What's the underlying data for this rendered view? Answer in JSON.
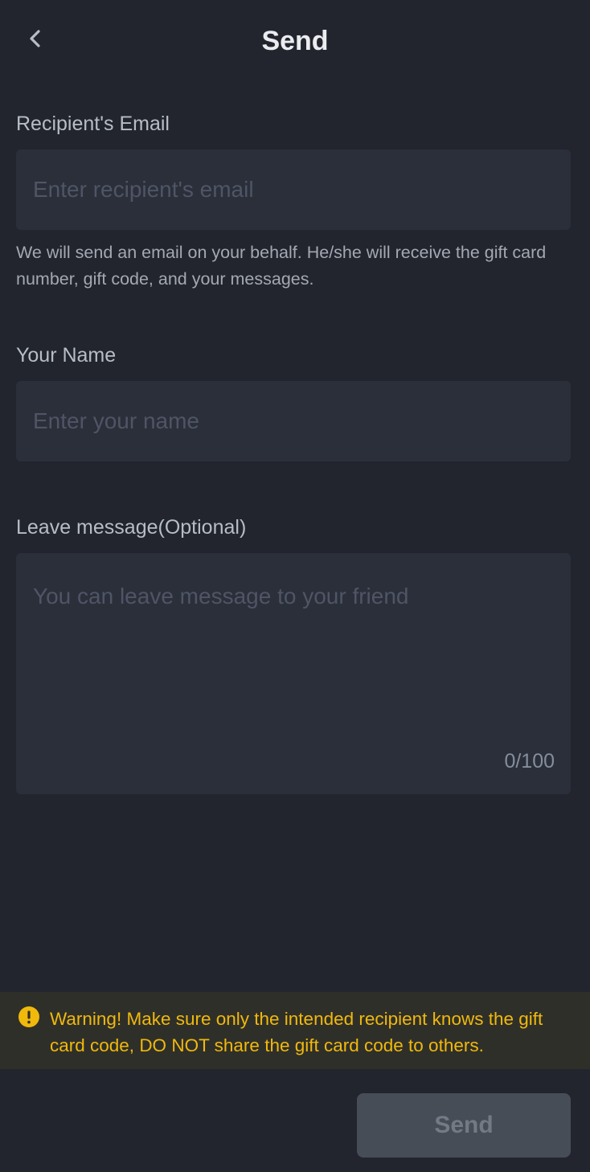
{
  "header": {
    "back_icon": "chevron-left-icon",
    "title": "Send"
  },
  "form": {
    "email": {
      "label": "Recipient's Email",
      "placeholder": "Enter recipient's email",
      "value": "",
      "helper": "We will send an email on your behalf. He/she will receive the gift card number, gift code, and your messages."
    },
    "name": {
      "label": "Your Name",
      "placeholder": "Enter your name",
      "value": ""
    },
    "message": {
      "label": "Leave message(Optional)",
      "placeholder": "You can leave message to your friend",
      "value": "",
      "counter": "0/100"
    }
  },
  "warning": {
    "icon": "exclamation-circle-icon",
    "text": "Warning! Make sure only the intended recipient knows the gift card code, DO NOT share the gift card code to others.",
    "color": "#f0b90b"
  },
  "footer": {
    "send_label": "Send"
  },
  "colors": {
    "background": "#22252e",
    "input_background": "#2b2f3a",
    "warning_background": "#2f2f2a",
    "button_disabled": "#474d57"
  }
}
